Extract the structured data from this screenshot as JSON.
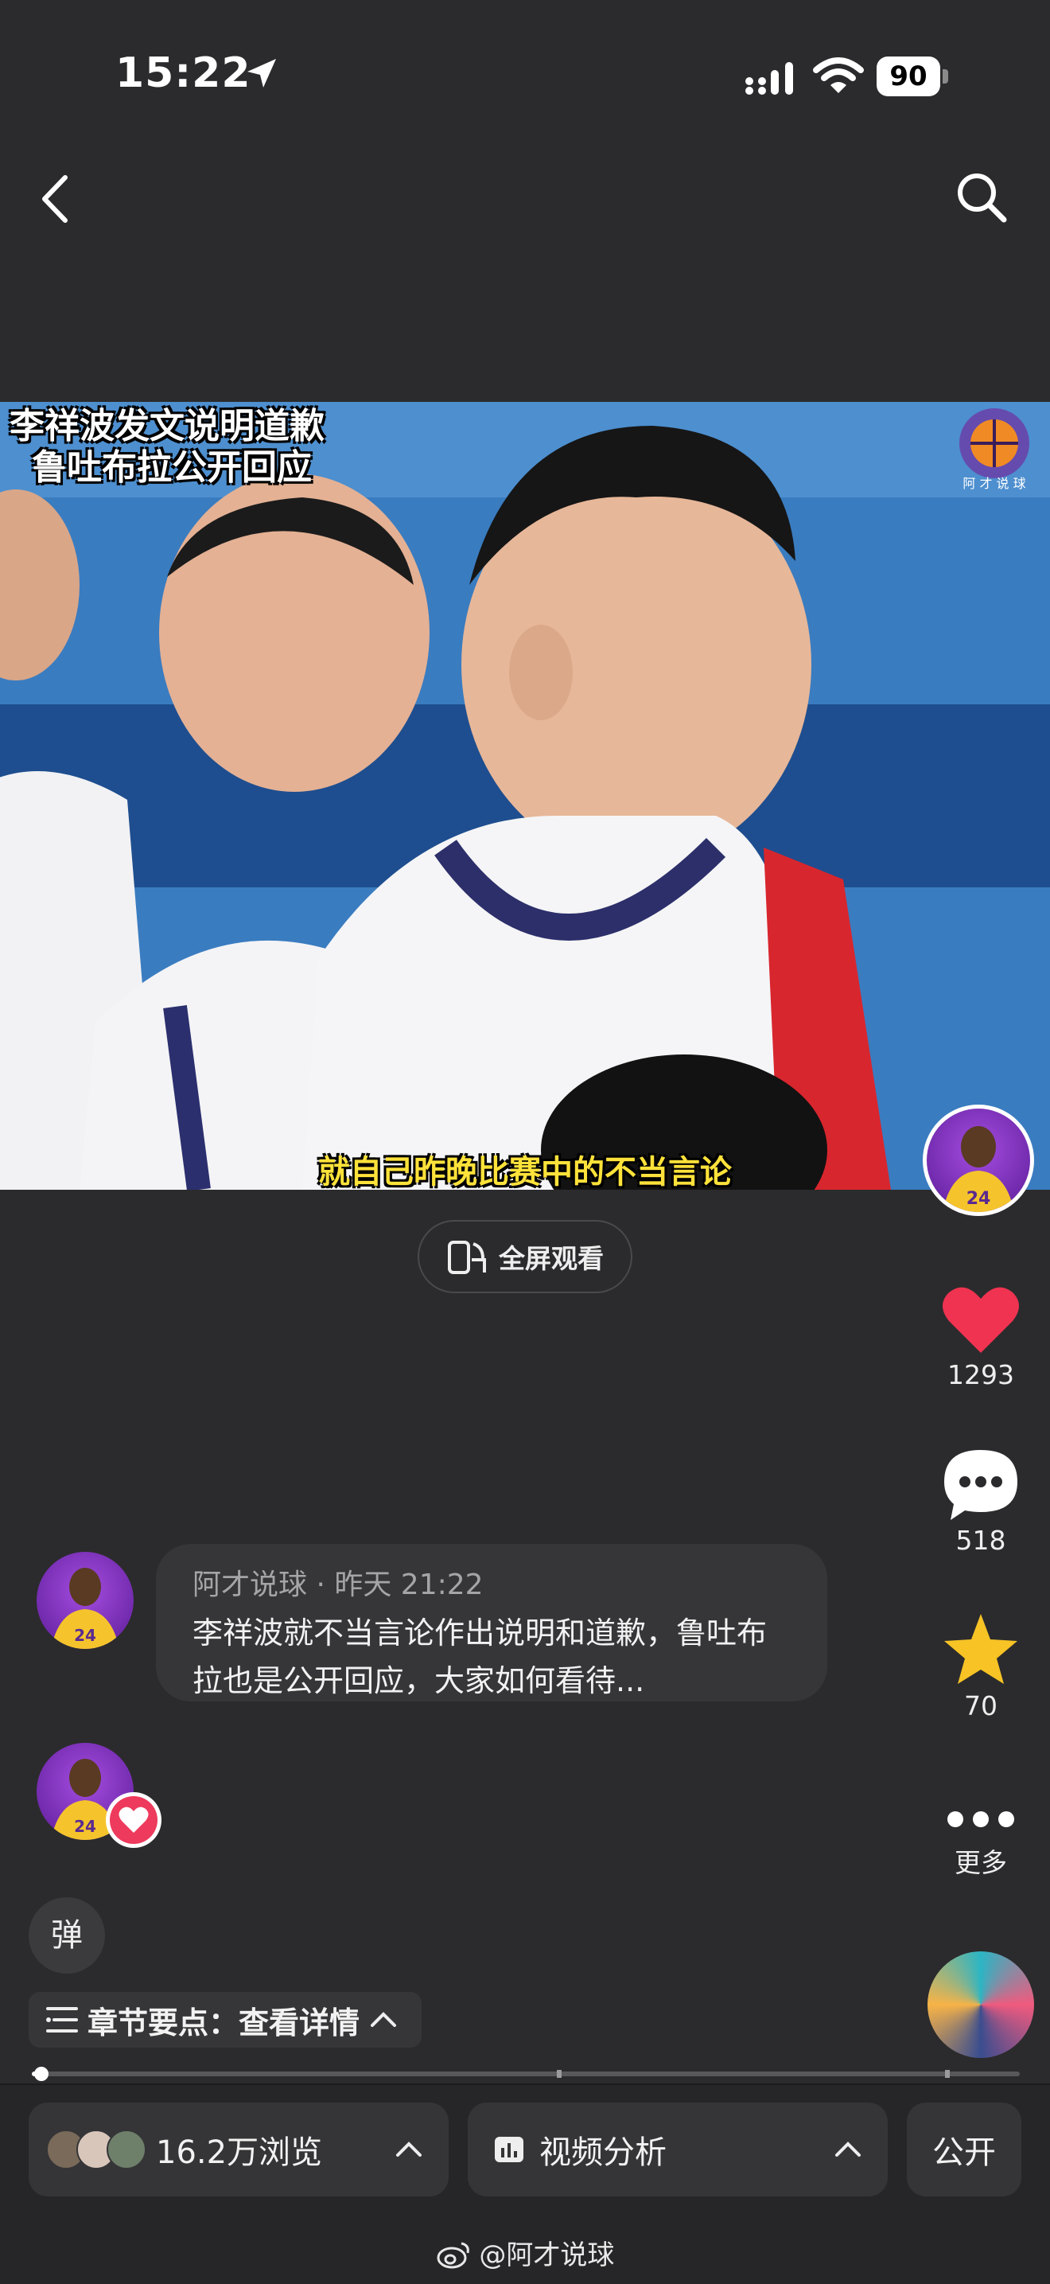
{
  "status_bar": {
    "time": "15:22",
    "battery": "90"
  },
  "video": {
    "headline_line1": "李祥波发文说明道歉",
    "headline_line2": "鲁吐布拉公开回应",
    "subtitle": "就自己昨晚比赛中的不当言论",
    "watermark": "阿 才 说 球",
    "fullscreen_label": "全屏观看"
  },
  "rail": {
    "likes": "1293",
    "comments": "518",
    "favorites": "70",
    "more_label": "更多"
  },
  "comment": {
    "author": "阿才说球",
    "separator": " · ",
    "time": "昨天 21:22",
    "text": "李祥波就不当言论作出说明和道歉，鲁吐布拉也是公开回应，大家如何看待..."
  },
  "danmu_label": "弹",
  "chapter": {
    "label": "章节要点：查看详情"
  },
  "progress": {
    "played_fraction": 0.01
  },
  "bottom_bar": {
    "views_label": "16.2万浏览",
    "analysis_label": "视频分析",
    "public_label": "公开"
  },
  "weibo_handle": "@阿才说球",
  "colors": {
    "like": "#f03350",
    "star": "#f7c325",
    "subtitle": "#ffe23a"
  }
}
